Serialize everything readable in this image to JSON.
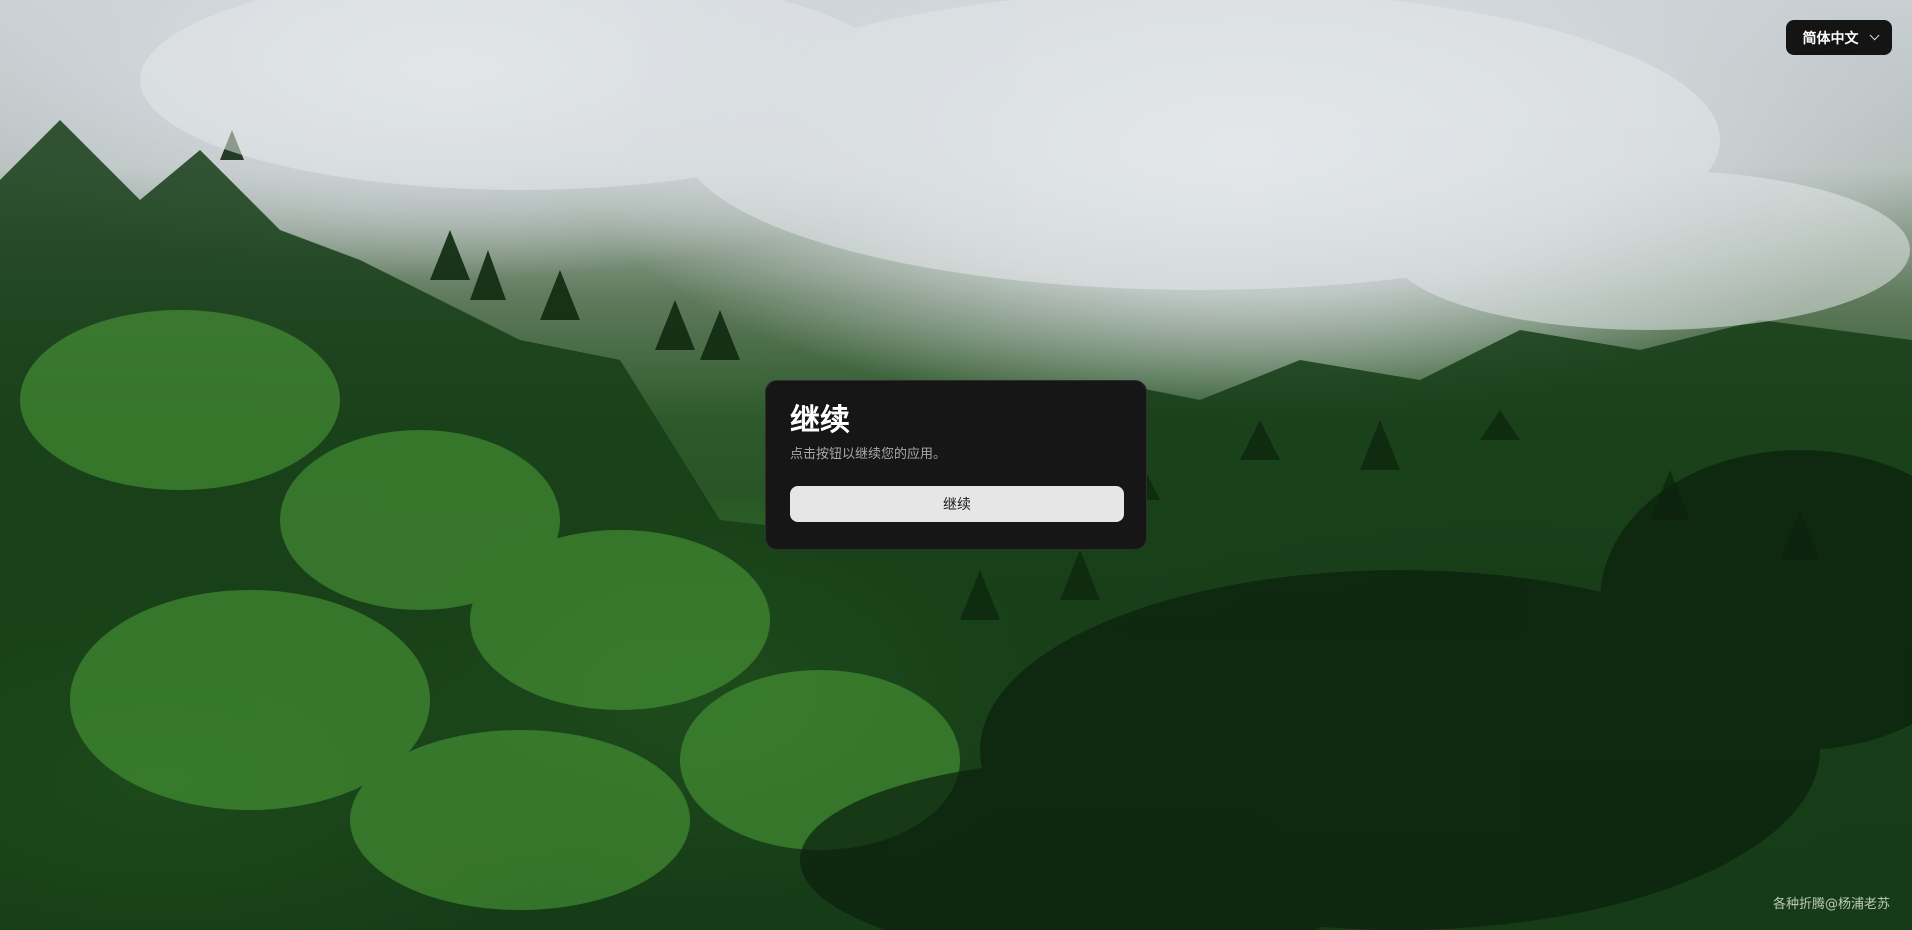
{
  "header": {
    "language_select": {
      "selected": "简体中文",
      "icon": "chevron-down-icon"
    }
  },
  "dialog": {
    "title": "继续",
    "description": "点击按钮以继续您的应用。",
    "button_label": "继续"
  },
  "footer": {
    "watermark": "各种折腾@杨浦老苏"
  },
  "colors": {
    "dialog_bg": "#171616",
    "button_bg": "#e6e6e6",
    "lang_button_bg": "#141414"
  }
}
